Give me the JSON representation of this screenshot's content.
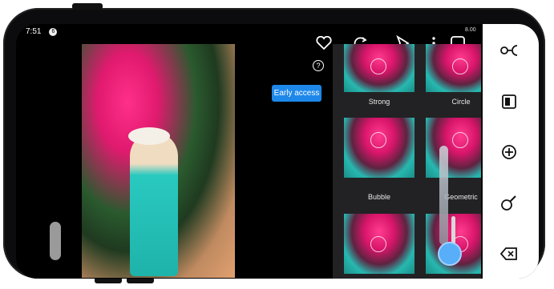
{
  "status": {
    "time": "7:51",
    "notif_badge": "6",
    "right_text": "8.00"
  },
  "help": {
    "label": "?"
  },
  "early_access": {
    "label": "Early access"
  },
  "top_icons": [
    "heart-outline-icon",
    "rotate-icon",
    "send-icon",
    "more-vertical-icon",
    "square-icon"
  ],
  "effects": [
    {
      "label": "Strong"
    },
    {
      "label": "Circle"
    },
    {
      "label": "Bubble"
    },
    {
      "label": "Geometric"
    }
  ],
  "toolbar": {
    "icons": [
      "link-icon",
      "image-layer-icon",
      "add-circle-icon",
      "brush-icon",
      "erase-icon"
    ]
  }
}
